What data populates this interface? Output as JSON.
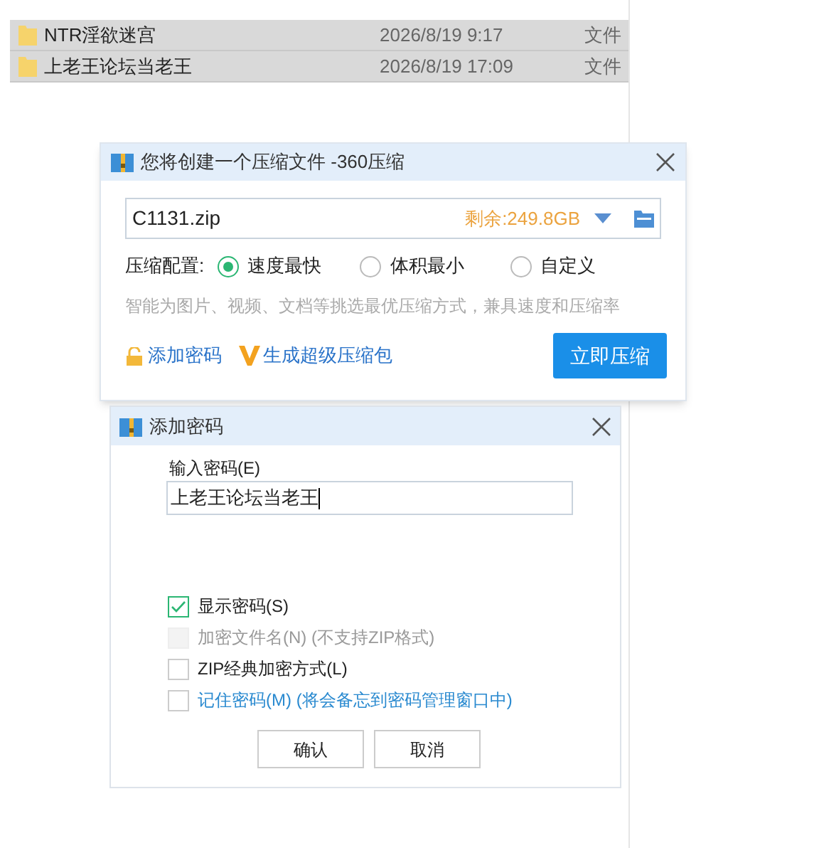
{
  "files": [
    {
      "name": "NTR淫欲迷宫",
      "modified": "2026/8/19 9:17",
      "type": "文件",
      "selected": true
    },
    {
      "name": "上老王论坛当老王",
      "modified": "2026/8/19 17:09",
      "type": "文件",
      "selected": true
    }
  ],
  "compress_dialog": {
    "title": "您将创建一个压缩文件 -360压缩",
    "filename": "C1131.zip",
    "free_space": "剩余:249.8GB",
    "config_label": "压缩配置:",
    "options": [
      {
        "label": "速度最快",
        "selected": true
      },
      {
        "label": "体积最小",
        "selected": false
      },
      {
        "label": "自定义",
        "selected": false
      }
    ],
    "hint": "智能为图片、视频、文档等挑选最优压缩方式，兼具速度和压缩率",
    "add_password": "添加密码",
    "super_package": "生成超级压缩包",
    "compress_button": "立即压缩"
  },
  "password_dialog": {
    "title": "添加密码",
    "field_label": "输入密码(E)",
    "password": "上老王论坛当老王",
    "checkboxes": [
      {
        "label": "显示密码(S)",
        "checked": true,
        "disabled": false,
        "kind": "plain"
      },
      {
        "label": "加密文件名(N) (不支持ZIP格式)",
        "checked": false,
        "disabled": true,
        "kind": "plain"
      },
      {
        "label": "ZIP经典加密方式(L)",
        "checked": false,
        "disabled": false,
        "kind": "plain"
      },
      {
        "label": "记住密码(M) (将会备忘到密码管理窗口中)",
        "checked": false,
        "disabled": false,
        "kind": "link"
      }
    ],
    "buttons": [
      "确认",
      "取消"
    ]
  }
}
